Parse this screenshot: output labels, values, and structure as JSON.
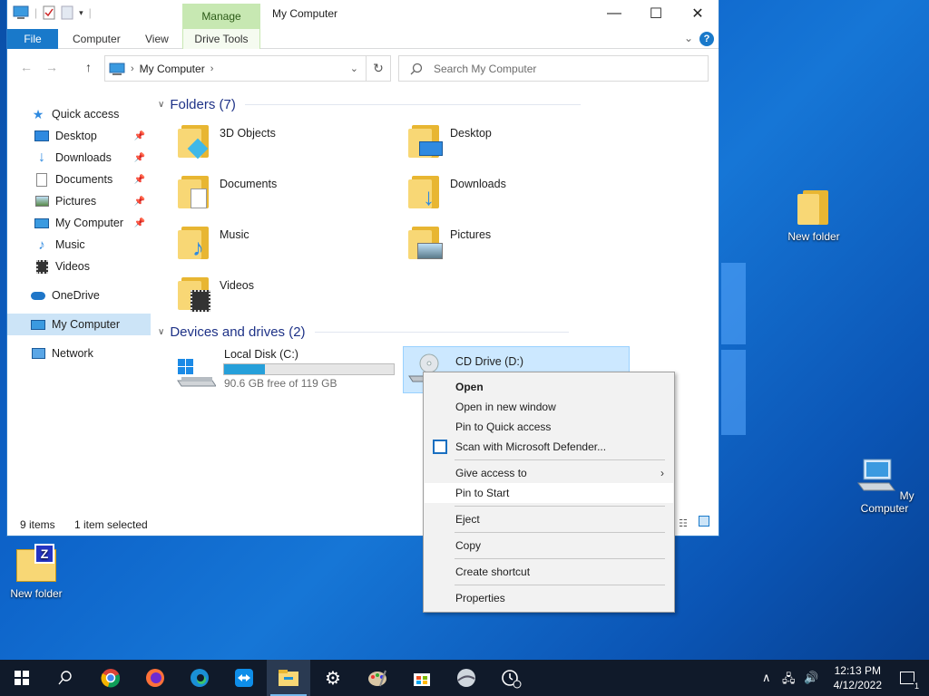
{
  "window": {
    "title": "My Computer",
    "context_tab_group": "Manage",
    "ribbon_tabs": [
      "File",
      "Computer",
      "View",
      "Drive Tools"
    ],
    "address": "My Computer",
    "search_placeholder": "Search My Computer"
  },
  "navpane": {
    "quick_access": "Quick access",
    "items": [
      {
        "label": "Desktop",
        "icon": "desktop-icon",
        "pinned": true
      },
      {
        "label": "Downloads",
        "icon": "downloads-icon",
        "pinned": true
      },
      {
        "label": "Documents",
        "icon": "documents-icon",
        "pinned": true
      },
      {
        "label": "Pictures",
        "icon": "pictures-icon",
        "pinned": true
      },
      {
        "label": "My Computer",
        "icon": "computer-icon",
        "pinned": true
      },
      {
        "label": "Music",
        "icon": "music-icon",
        "pinned": false
      },
      {
        "label": "Videos",
        "icon": "videos-icon",
        "pinned": false
      }
    ],
    "onedrive": "OneDrive",
    "this_pc": "My Computer",
    "network": "Network"
  },
  "content": {
    "folders_header": "Folders (7)",
    "folders": [
      "3D Objects",
      "Desktop",
      "Documents",
      "Downloads",
      "Music",
      "Pictures",
      "Videos"
    ],
    "drives_header": "Devices and drives (2)",
    "drives": [
      {
        "label": "Local Disk (C:)",
        "free": "90.6 GB free of 119 GB",
        "used_fraction": 0.24
      },
      {
        "label": "CD Drive (D:)"
      }
    ]
  },
  "status": {
    "items": "9 items",
    "selected": "1 item selected"
  },
  "context_menu": {
    "open": "Open",
    "open_new_window": "Open in new window",
    "pin_quick": "Pin to Quick access",
    "scan": "Scan with Microsoft Defender...",
    "give_access": "Give access to",
    "pin_start": "Pin to Start",
    "eject": "Eject",
    "copy": "Copy",
    "create_shortcut": "Create shortcut",
    "properties": "Properties"
  },
  "desktop": {
    "icons": [
      "New folder",
      "My Computer",
      "New folder"
    ]
  },
  "taskbar": {
    "time": "12:13 PM",
    "date": "4/12/2022",
    "notification_count": "1"
  },
  "colors": {
    "accent": "#1979ca",
    "manage_tab": "#c7e8b2",
    "selection": "#cce4f7",
    "taskbar": "#101a2a"
  }
}
